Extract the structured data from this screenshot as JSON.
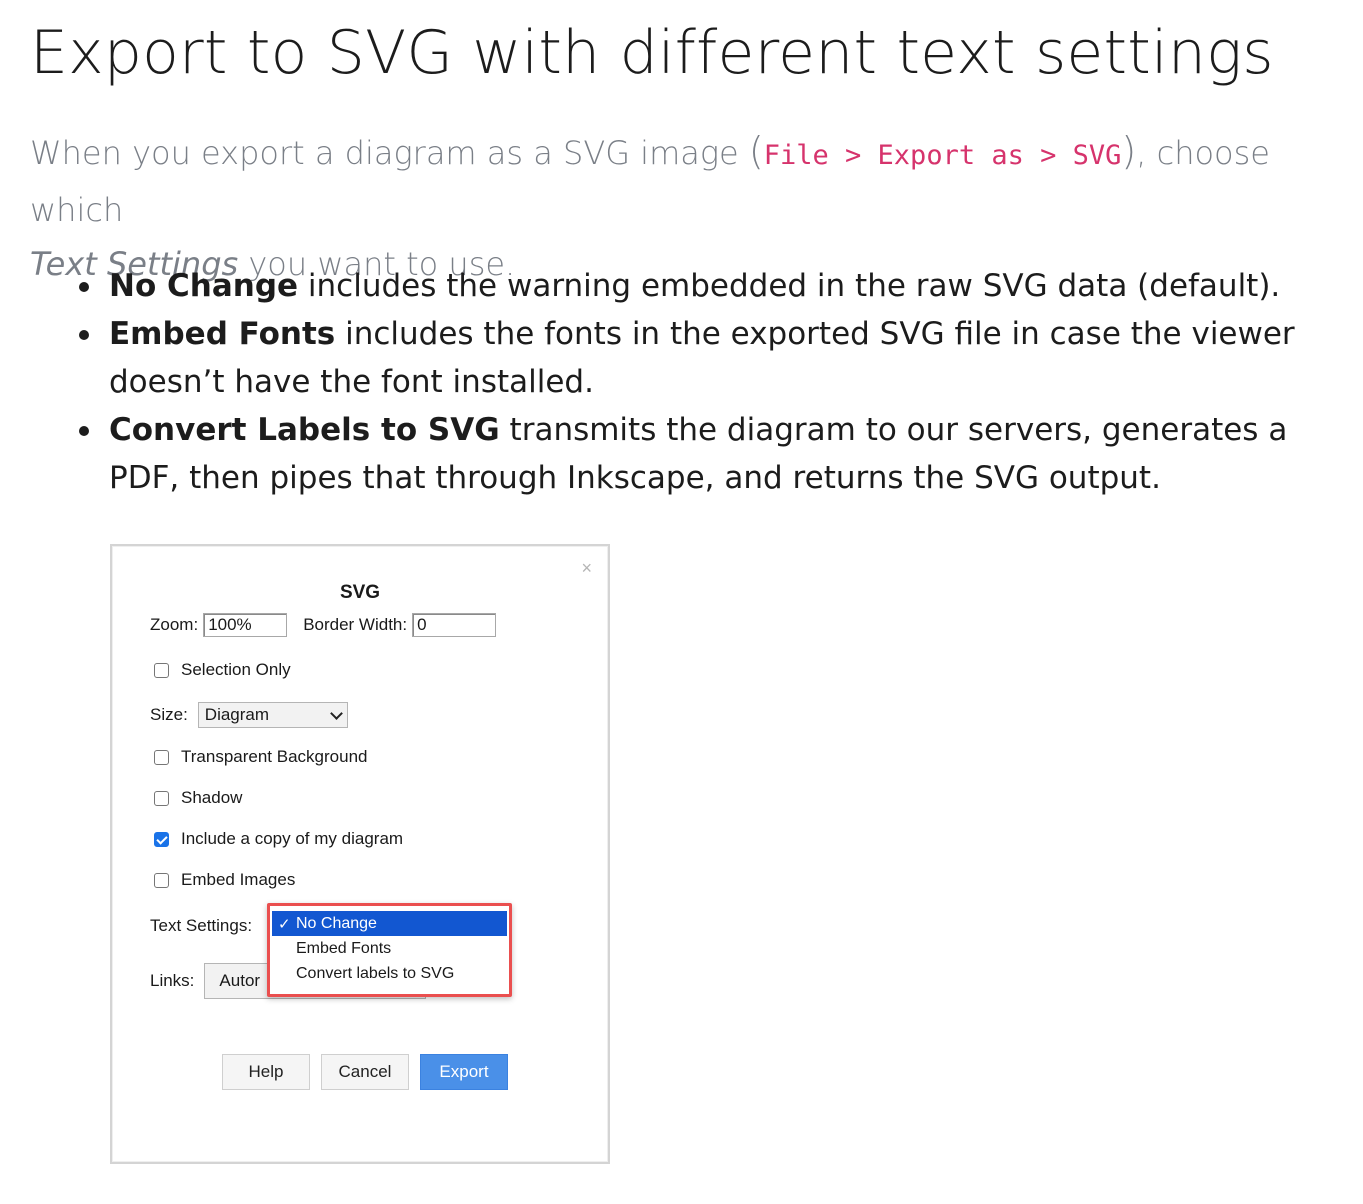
{
  "title": "Export to SVG with different text settings",
  "intro": {
    "before": "When you export a diagram as a SVG image ",
    "open_paren": "(",
    "path_file": "File",
    "path_sep1": " > ",
    "path_export": "Export as",
    "path_sep2": " > ",
    "path_svg": "SVG",
    "close_paren": ")",
    "after": ", choose which ",
    "emphasis": "Text Settings",
    "end": " you want to use."
  },
  "bullets": [
    {
      "term": "No Change",
      "text": " includes the warning embedded in the raw SVG data (default)."
    },
    {
      "term": "Embed Fonts",
      "text": " includes the fonts in the exported SVG file in case the viewer doesn’t have the font installed."
    },
    {
      "term": "Convert Labels to SVG",
      "text": " transmits the diagram to our servers, generates a PDF, then pipes that through Inkscape, and returns the SVG output."
    }
  ],
  "dialog": {
    "close_glyph": "×",
    "title": "SVG",
    "zoom_label": "Zoom:",
    "zoom_value": "100%",
    "border_label": "Border Width:",
    "border_value": "0",
    "selection_only": "Selection Only",
    "size_label": "Size:",
    "size_value": "Diagram",
    "transparent_bg": "Transparent Background",
    "shadow": "Shadow",
    "include_copy": "Include a copy of my diagram",
    "include_copy_checked": true,
    "embed_images": "Embed Images",
    "text_settings_label": "Text Settings:",
    "text_settings_options": [
      "No Change",
      "Embed Fonts",
      "Convert labels to SVG"
    ],
    "selected_check": "✓",
    "links_label": "Links:",
    "links_value": "Autor",
    "help": "Help",
    "cancel": "Cancel",
    "export": "Export"
  },
  "colors": {
    "code": "#d6336c",
    "intro_text": "#7a7f87",
    "primary_button": "#4a90e8",
    "menu_highlight": "#1257d1",
    "annotation_border": "#ea4f4f"
  }
}
